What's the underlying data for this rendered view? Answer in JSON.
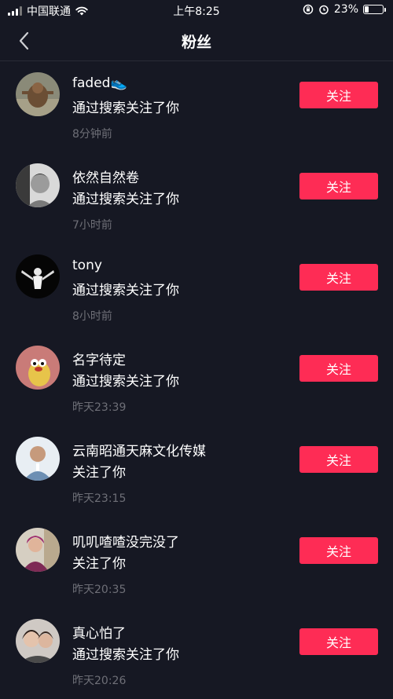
{
  "status_bar": {
    "carrier": "中国联通",
    "time": "上午8:25",
    "battery": "23%",
    "battery_level": 0.23,
    "icons": [
      "signal-icon",
      "wifi-icon",
      "rotation-lock-icon",
      "alarm-icon",
      "battery-icon"
    ]
  },
  "nav": {
    "title": "粉丝",
    "back_icon": "chevron-left-icon"
  },
  "colors": {
    "background": "#161823",
    "follow_button": "#fe2c55",
    "time_text": "#6e6f77"
  },
  "followers": [
    {
      "name": "faded👟",
      "action": "通过搜索关注了你",
      "time": "8分钟前",
      "button": "关注"
    },
    {
      "name": "依然自然卷",
      "action": "通过搜索关注了你",
      "time": "7小时前",
      "button": "关注"
    },
    {
      "name": "tony",
      "action": "通过搜索关注了你",
      "time": "8小时前",
      "button": "关注"
    },
    {
      "name": "名字待定",
      "action": "通过搜索关注了你",
      "time": "昨天23:39",
      "button": "关注"
    },
    {
      "name": "云南昭通天麻文化传媒",
      "action": "关注了你",
      "time": "昨天23:15",
      "button": "关注"
    },
    {
      "name": "叽叽喳喳没完没了",
      "action": "关注了你",
      "time": "昨天20:35",
      "button": "关注"
    },
    {
      "name": "真心怕了",
      "action": "通过搜索关注了你",
      "time": "昨天20:26",
      "button": "关注"
    }
  ]
}
